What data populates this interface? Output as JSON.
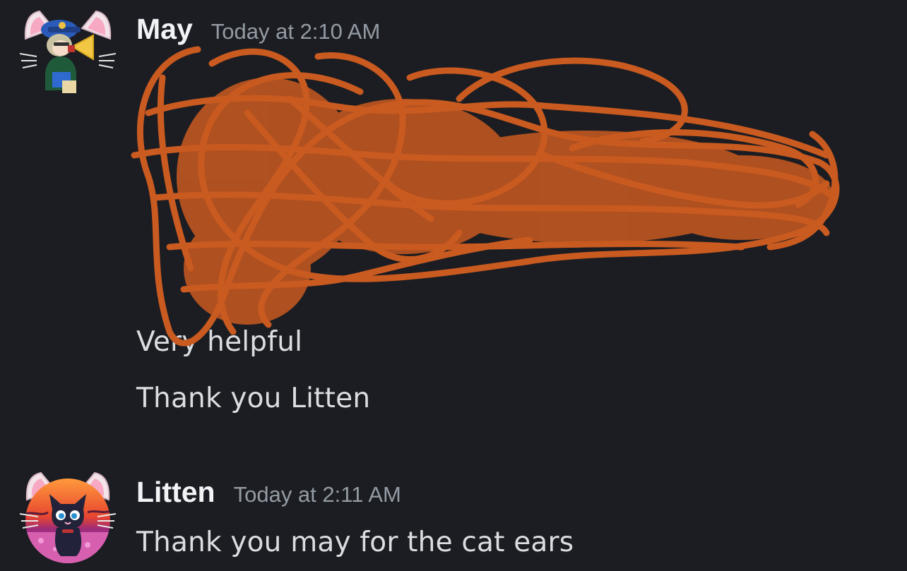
{
  "messages": [
    {
      "author": "May",
      "timestamp": "Today at 2:10 AM",
      "lines": [
        "Very helpful",
        "Thank you Litten"
      ],
      "avatar_icon": "may-avatar-with-cat-ears-icon"
    },
    {
      "author": "Litten",
      "timestamp": "Today at 2:11 AM",
      "lines": [
        "Thank you may for the cat ears"
      ],
      "avatar_icon": "litten-black-cat-avatar-with-cat-ears-icon"
    }
  ],
  "colors": {
    "background": "#1c1d22",
    "username": "#f2f3f5",
    "timestamp": "#949ba4",
    "message_text": "#dbdee1",
    "scribble": "#c95a20"
  }
}
